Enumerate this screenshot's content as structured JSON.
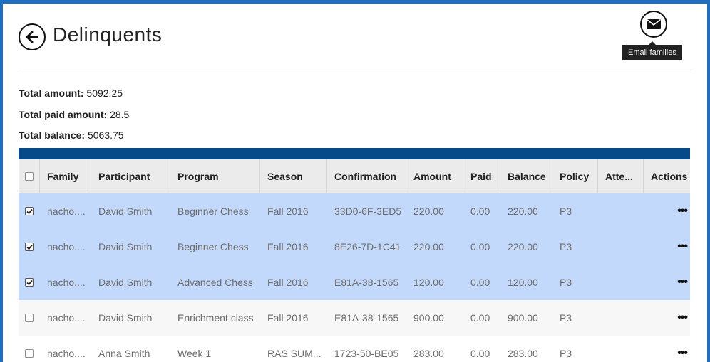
{
  "header": {
    "title": "Delinquents",
    "back_icon": "arrow-left-circle-icon",
    "email_icon": "envelope-icon",
    "email_tooltip": "Email families"
  },
  "totals": {
    "total_amount_label": "Total amount:",
    "total_amount_value": "5092.25",
    "total_paid_label": "Total paid amount:",
    "total_paid_value": "28.5",
    "total_balance_label": "Total balance:",
    "total_balance_value": "5063.75"
  },
  "colors": {
    "frame_border": "#1e6fc1",
    "header_bar": "#064a8a",
    "selected_row": "#c3d9fb",
    "plain_row": "#f7f7f7"
  },
  "table": {
    "columns": [
      "Family",
      "Participant",
      "Program",
      "Season",
      "Confirmation",
      "Amount",
      "Paid",
      "Balance",
      "Policy",
      "Atte...",
      "Actions"
    ],
    "rows": [
      {
        "checked": true,
        "family": "nacho....",
        "participant": "David Smith",
        "program": "Beginner Chess",
        "season": "Fall 2016",
        "confirmation": "33D0-6F-3ED5",
        "amount": "220.00",
        "paid": "0.00",
        "balance": "220.00",
        "policy": "P3",
        "attendance": "",
        "actions": "•••"
      },
      {
        "checked": true,
        "family": "nacho....",
        "participant": "David Smith",
        "program": "Beginner Chess",
        "season": "Fall 2016",
        "confirmation": "8E26-7D-1C41",
        "amount": "220.00",
        "paid": "0.00",
        "balance": "220.00",
        "policy": "P3",
        "attendance": "",
        "actions": "•••"
      },
      {
        "checked": true,
        "family": "nacho....",
        "participant": "David Smith",
        "program": "Advanced Chess",
        "season": "Fall 2016",
        "confirmation": "E81A-38-1565",
        "amount": "120.00",
        "paid": "0.00",
        "balance": "120.00",
        "policy": "P3",
        "attendance": "",
        "actions": "•••"
      },
      {
        "checked": false,
        "family": "nacho....",
        "participant": "David Smith",
        "program": "Enrichment class",
        "season": "Fall 2016",
        "confirmation": "E81A-38-1565",
        "amount": "900.00",
        "paid": "0.00",
        "balance": "900.00",
        "policy": "P3",
        "attendance": "",
        "actions": "•••"
      },
      {
        "checked": false,
        "family": "nacho....",
        "participant": "Anna Smith",
        "program": "Week 1",
        "season": "RAS SUM...",
        "confirmation": "1723-50-BE05",
        "amount": "283.00",
        "paid": "0.00",
        "balance": "283.00",
        "policy": "P3",
        "attendance": "",
        "actions": "•••"
      }
    ]
  }
}
